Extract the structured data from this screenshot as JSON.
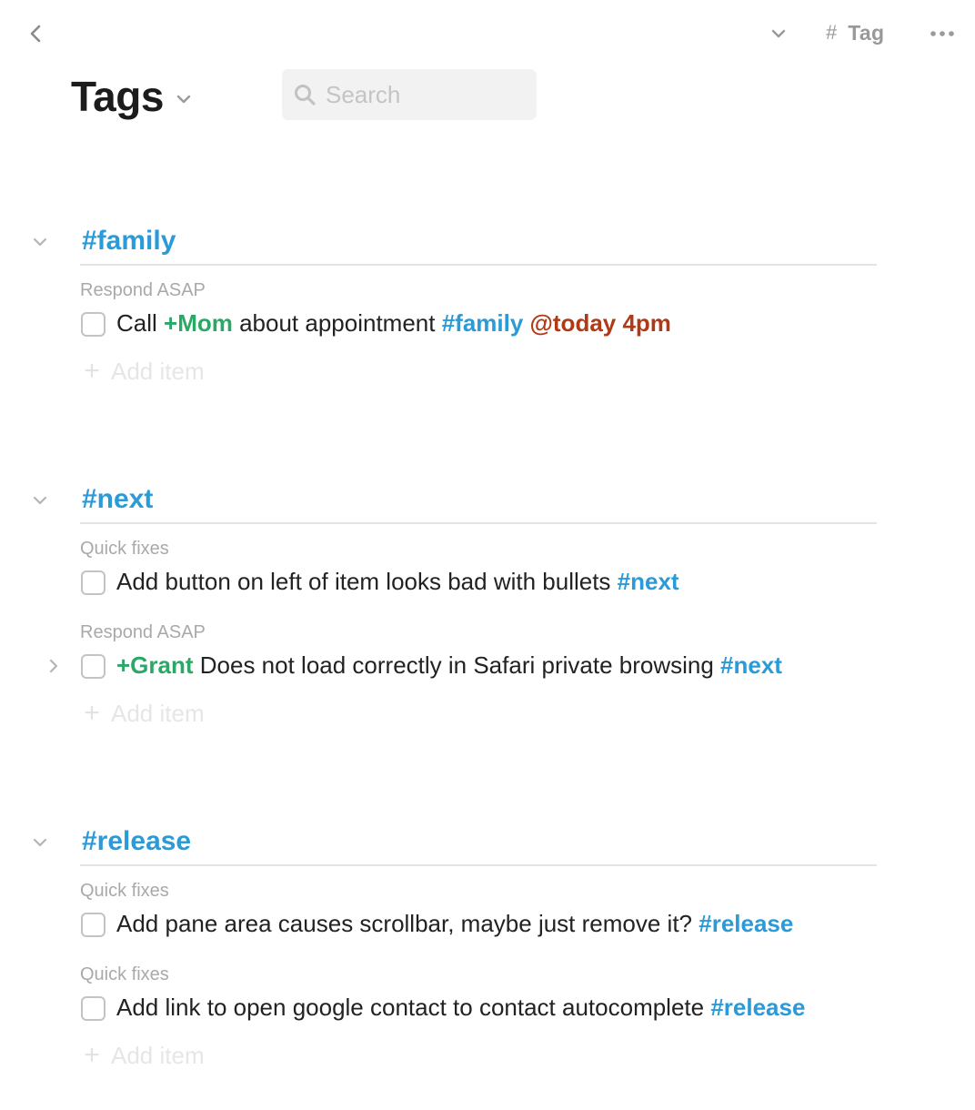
{
  "toolbar": {
    "tag_hash": "#",
    "tag_label": "Tag"
  },
  "header": {
    "title": "Tags"
  },
  "search": {
    "placeholder": "Search",
    "value": ""
  },
  "sections": [
    {
      "title": "#family",
      "add_label": "Add item",
      "groups": [
        {
          "label": "Respond ASAP",
          "items": [
            {
              "has_children": false,
              "tokens": [
                {
                  "t": "Call ",
                  "k": "text"
                },
                {
                  "t": "+Mom",
                  "k": "person"
                },
                {
                  "t": " about appointment ",
                  "k": "text"
                },
                {
                  "t": "#family",
                  "k": "tag"
                },
                {
                  "t": " ",
                  "k": "text"
                },
                {
                  "t": "@today 4pm",
                  "k": "date"
                }
              ]
            }
          ]
        }
      ]
    },
    {
      "title": "#next",
      "add_label": "Add item",
      "groups": [
        {
          "label": "Quick fixes",
          "items": [
            {
              "has_children": false,
              "tokens": [
                {
                  "t": "Add button on left of item looks bad with bullets ",
                  "k": "text"
                },
                {
                  "t": "#next",
                  "k": "tag"
                }
              ]
            }
          ]
        },
        {
          "label": "Respond ASAP",
          "items": [
            {
              "has_children": true,
              "tokens": [
                {
                  "t": "+Grant",
                  "k": "person"
                },
                {
                  "t": " Does not load correctly in Safari private browsing ",
                  "k": "text"
                },
                {
                  "t": "#next",
                  "k": "tag"
                }
              ]
            }
          ]
        }
      ]
    },
    {
      "title": "#release",
      "add_label": "Add item",
      "groups": [
        {
          "label": "Quick fixes",
          "items": [
            {
              "has_children": false,
              "tokens": [
                {
                  "t": "Add pane area causes scrollbar, maybe just remove it? ",
                  "k": "text"
                },
                {
                  "t": "#release",
                  "k": "tag"
                }
              ]
            }
          ]
        },
        {
          "label": "Quick fixes",
          "items": [
            {
              "has_children": false,
              "tokens": [
                {
                  "t": "Add link to open google contact to contact autocomplete ",
                  "k": "text"
                },
                {
                  "t": "#release",
                  "k": "tag"
                }
              ]
            }
          ]
        }
      ]
    }
  ],
  "colors": {
    "tag": "#2a9ad8",
    "person": "#2aa865",
    "date": "#b03a16",
    "muted": "#a9a9a9"
  },
  "icons": {
    "back": "chevron-left-icon",
    "view_menu": "chevron-down-icon",
    "more": "more-horizontal-icon",
    "search": "search-icon",
    "collapse": "chevron-down-icon",
    "expand": "chevron-right-icon",
    "add": "plus-icon"
  }
}
